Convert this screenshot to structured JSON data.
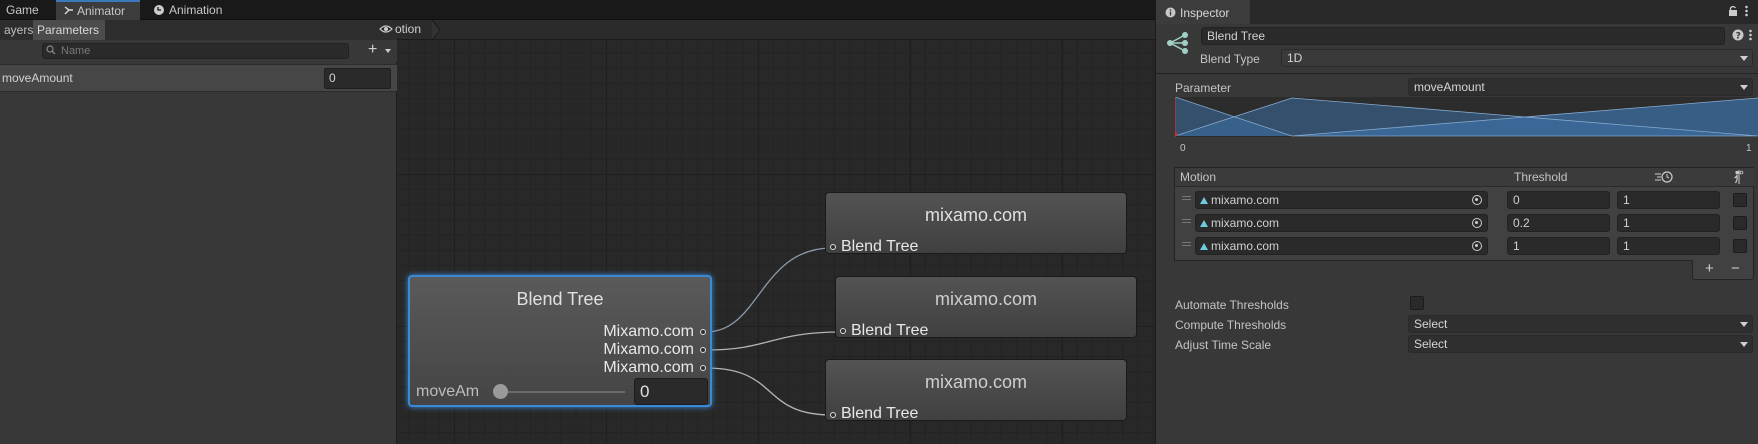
{
  "tabs": [
    {
      "label": "Game",
      "icon": "gamepad-icon"
    },
    {
      "label": "Animator",
      "icon": "animator-icon"
    },
    {
      "label": "Animation",
      "icon": "animation-icon"
    }
  ],
  "params_panel": {
    "subtabs": [
      "ayers",
      "Parameters"
    ],
    "search_placeholder": "Name",
    "add_label": "+",
    "parameter": {
      "name": "moveAmount",
      "value": "0"
    }
  },
  "graph": {
    "breadcrumb": "otion",
    "blend_node": {
      "title": "Blend Tree",
      "outputs": [
        "Mixamo.com",
        "Mixamo.com",
        "Mixamo.com"
      ],
      "param_label": "moveAm",
      "param_value": "0",
      "slider_value": 0
    },
    "child_nodes": [
      {
        "title": "mixamo.com",
        "port": "Blend Tree"
      },
      {
        "title": "mixamo.com",
        "port": "Blend Tree"
      },
      {
        "title": "mixamo.com",
        "port": "Blend Tree"
      }
    ]
  },
  "inspector": {
    "tab_label": "Inspector",
    "name_value": "Blend Tree",
    "blend_type_label": "Blend Type",
    "blend_type_value": "1D",
    "parameter_label": "Parameter",
    "parameter_value": "moveAmount",
    "graph_min": "0",
    "graph_max": "1",
    "table_headers": {
      "motion": "Motion",
      "threshold": "Threshold"
    },
    "rows": [
      {
        "motion": "mixamo.com",
        "threshold": "0",
        "speed": "1",
        "mirror": false
      },
      {
        "motion": "mixamo.com",
        "threshold": "0.2",
        "speed": "1",
        "mirror": false
      },
      {
        "motion": "mixamo.com",
        "threshold": "1",
        "speed": "1",
        "mirror": false
      }
    ],
    "add_label": "+",
    "remove_label": "−",
    "automate_label": "Automate Thresholds",
    "automate_checked": false,
    "compute_label": "Compute Thresholds",
    "compute_value": "Select",
    "adjust_label": "Adjust Time Scale",
    "adjust_value": "Select"
  }
}
